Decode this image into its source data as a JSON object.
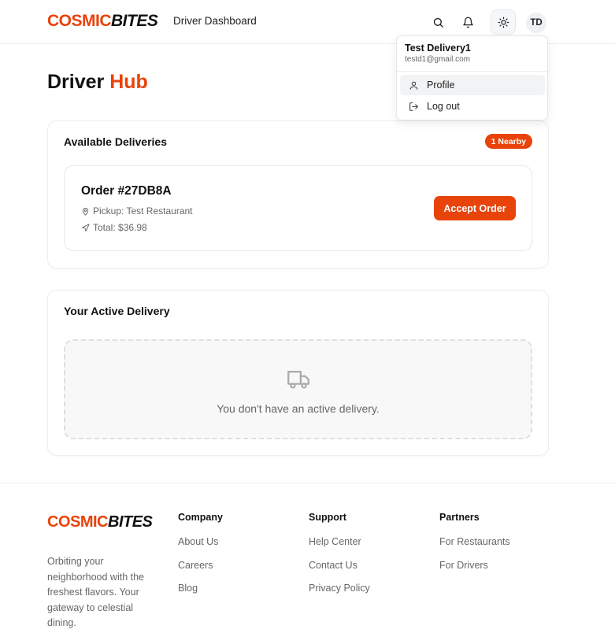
{
  "header": {
    "logo_part1": "COSMIC",
    "logo_part2": "BITES",
    "nav_link": "Driver Dashboard",
    "avatar_initials": "TD",
    "icons": [
      "search-icon",
      "bell-icon",
      "sun-icon"
    ]
  },
  "user_menu": {
    "name": "Test Delivery1",
    "email": "testd1@gmail.com",
    "items": [
      {
        "label": "Profile",
        "icon": "user-icon"
      },
      {
        "label": "Log out",
        "icon": "logout-icon"
      }
    ]
  },
  "page": {
    "title_part1": "Driver",
    "title_part2": "Hub"
  },
  "available": {
    "title": "Available Deliveries",
    "badge": "1 Nearby",
    "order": {
      "id": "Order #27DB8A",
      "pickup": "Pickup: Test Restaurant",
      "total": "Total: $36.98",
      "accept_label": "Accept Order"
    }
  },
  "active": {
    "title": "Your Active Delivery",
    "empty_text": "You don't have an active delivery."
  },
  "footer": {
    "logo_part1": "COSMIC",
    "logo_part2": "BITES",
    "tagline": "Orbiting your neighborhood with the freshest flavors. Your gateway to celestial dining.",
    "columns": [
      {
        "title": "Company",
        "links": [
          "About Us",
          "Careers",
          "Blog"
        ]
      },
      {
        "title": "Support",
        "links": [
          "Help Center",
          "Contact Us",
          "Privacy Policy"
        ]
      },
      {
        "title": "Partners",
        "links": [
          "For Restaurants",
          "For Drivers"
        ]
      }
    ]
  },
  "colors": {
    "accent": "#e8430b",
    "text": "#111111",
    "muted": "#666666",
    "border": "#eceef1"
  }
}
